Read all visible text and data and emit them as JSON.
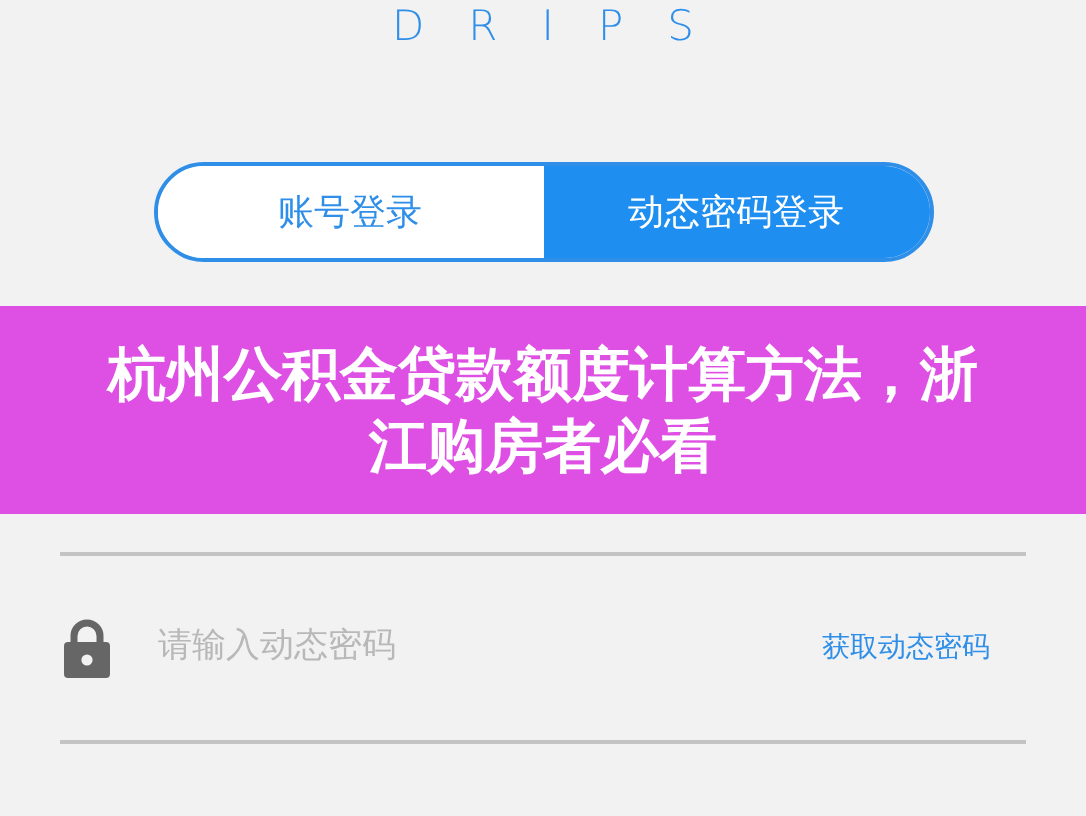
{
  "logo": "DRIPS",
  "tabs": [
    {
      "label": "账号登录",
      "selected": false
    },
    {
      "label": "动态密码登录",
      "selected": true
    }
  ],
  "fields": [
    {
      "kind": "lock",
      "placeholder": "请输入动态密码",
      "action": "获取动态密码"
    }
  ],
  "banner": {
    "title": "杭州公积金贷款额度计算方法，浙江购房者必看"
  }
}
